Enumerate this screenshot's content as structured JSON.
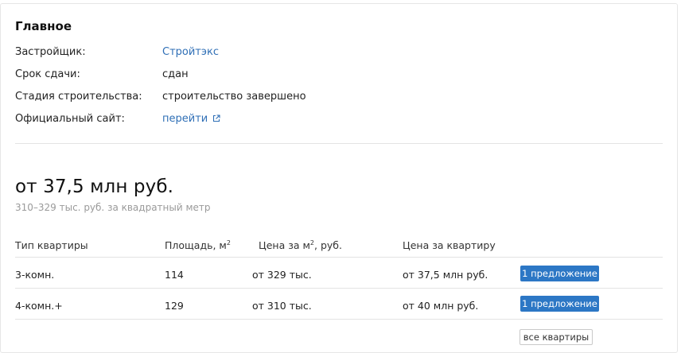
{
  "main": {
    "title": "Главное",
    "info": [
      {
        "label": "Застройщик:",
        "value": "Стройтэкс"
      },
      {
        "label": "Срок сдачи:",
        "value": "сдан"
      },
      {
        "label": "Стадия строительства:",
        "value": "строительство завершено"
      },
      {
        "label": "Официальный сайт:",
        "value": "перейти"
      }
    ]
  },
  "price": {
    "headline": "от 37,5 млн руб.",
    "per_meter": "310–329 тыс. руб. за квадратный метр"
  },
  "table": {
    "headers": {
      "type": "Тип квартиры",
      "area": "Площадь, м",
      "area_sup": "2",
      "price_per_m_a": "Цена за м",
      "price_per_m_sup": "2",
      "price_per_m_b": ", руб.",
      "price_total": "Цена за квартиру"
    },
    "rows": [
      {
        "type": "3-комн.",
        "area": "114",
        "price_per_m": "от 329 тыс.",
        "price_total": "от 37,5 млн руб.",
        "button": "1 предложение"
      },
      {
        "type": "4-комн.+",
        "area": "129",
        "price_per_m": "от 310 тыс.",
        "price_total": "от 40 млн руб.",
        "button": "1 предложение"
      }
    ],
    "all_button": "все квартиры"
  },
  "colors": {
    "link": "#2f6fb6",
    "button": "#2c77c5"
  },
  "icons": {
    "external_link": "external-link-icon"
  }
}
